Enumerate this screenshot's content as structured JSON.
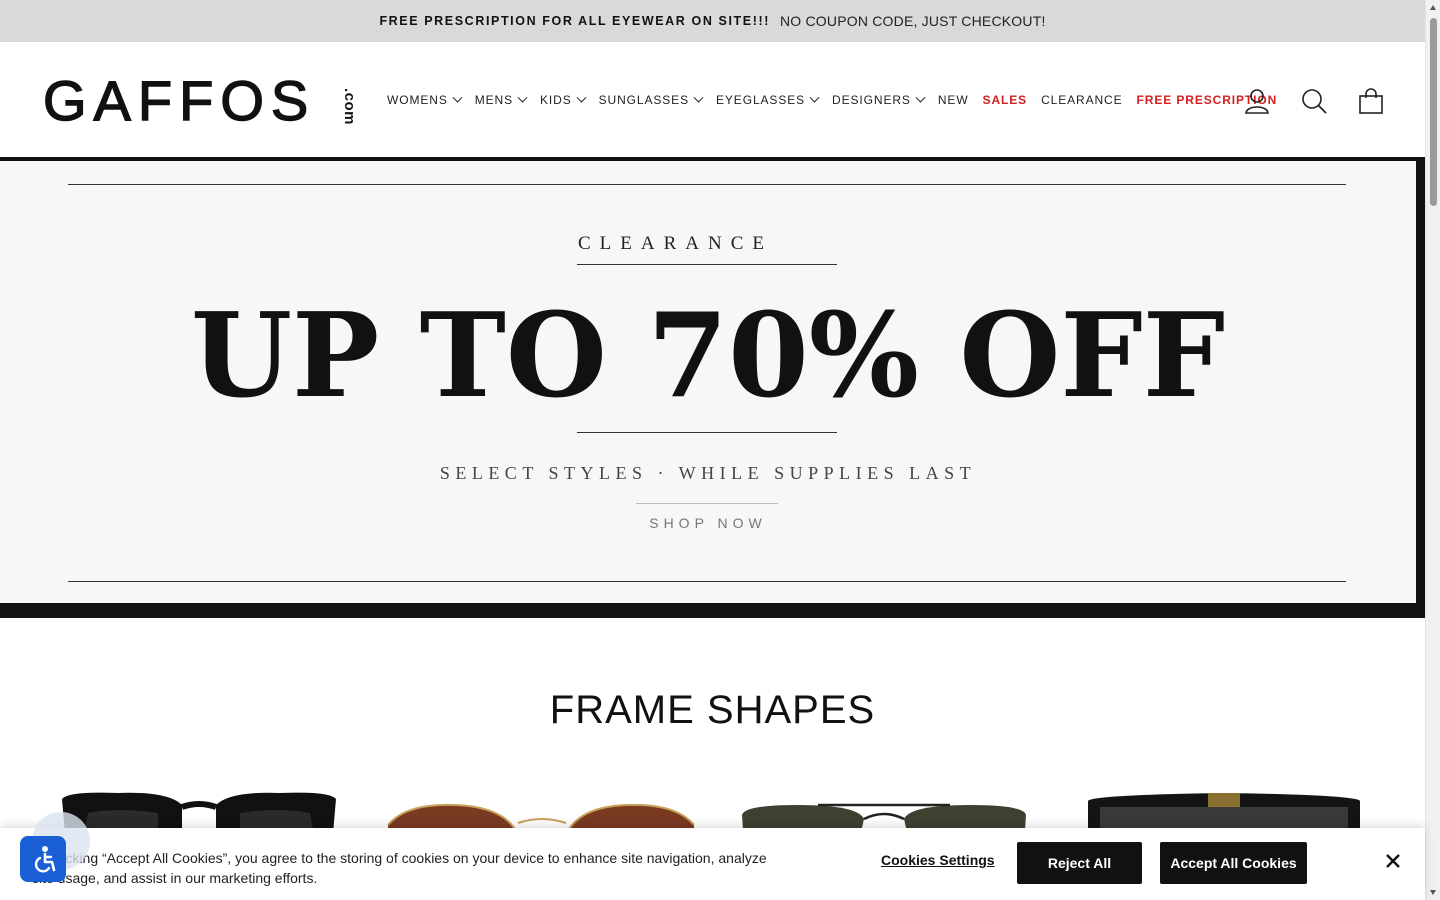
{
  "announcement": {
    "strong": "FREE PRESCRIPTION FOR ALL EYEWEAR ON SITE!!!",
    "rest": "NO COUPON CODE, JUST CHECKOUT!"
  },
  "logo": {
    "word": "GAFFOS",
    "suffix": ".com"
  },
  "nav": {
    "items": [
      {
        "label": "WOMENS",
        "dropdown": true
      },
      {
        "label": "MENS",
        "dropdown": true
      },
      {
        "label": "KIDS",
        "dropdown": true
      },
      {
        "label": "SUNGLASSES",
        "dropdown": true
      },
      {
        "label": "EYEGLASSES",
        "dropdown": true
      },
      {
        "label": "DESIGNERS",
        "dropdown": true
      },
      {
        "label": "NEW",
        "dropdown": false
      },
      {
        "label": "SALES",
        "dropdown": false,
        "highlight": true
      },
      {
        "label": "CLEARANCE",
        "dropdown": false
      },
      {
        "label": "FREE PRESCRIPTION",
        "dropdown": false,
        "highlight": true
      }
    ]
  },
  "header_icons": [
    "account-icon",
    "search-icon",
    "cart-icon"
  ],
  "hero": {
    "kicker": "CLEARANCE",
    "headline": "UP TO 70% OFF",
    "subline": "SELECT STYLES · WHILE SUPPLIES LAST",
    "cta": "SHOP NOW"
  },
  "section": {
    "title": "FRAME SHAPES"
  },
  "cookie": {
    "message": "By clicking “Accept All Cookies”, you agree to the storing of cookies on your device to enhance site navigation, analyze site usage, and assist in our marketing efforts.",
    "settings_label": "Cookies Settings",
    "reject_label": "Reject All",
    "accept_label": "Accept All Cookies"
  },
  "colors": {
    "announcement_bg": "#d9d9d9",
    "highlight_red": "#d42020",
    "accessibility_blue": "#1a5fd6",
    "button_black": "#111111"
  }
}
